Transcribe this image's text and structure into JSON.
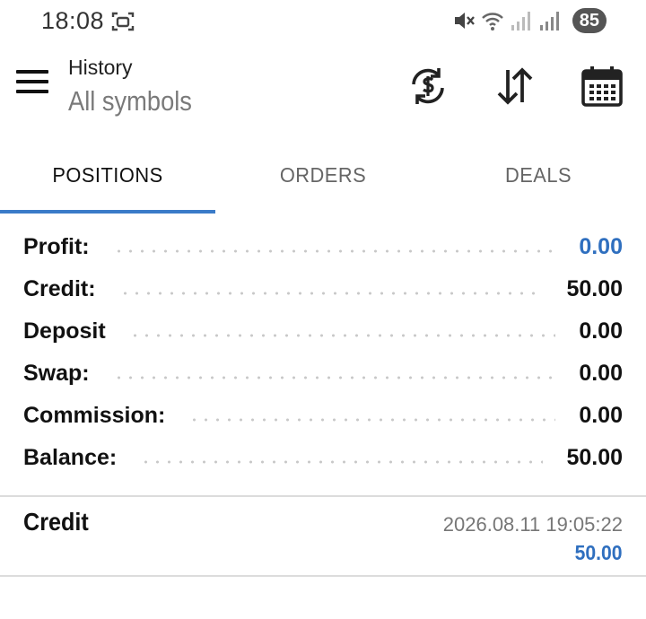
{
  "status_bar": {
    "time": "18:08",
    "battery": "85",
    "icons": [
      "screenshot-icon",
      "mute-icon",
      "wifi-icon",
      "signal-icon",
      "signal-icon"
    ]
  },
  "header": {
    "title": "History",
    "subtitle": "All symbols",
    "actions": [
      "currency-sync-icon",
      "sort-icon",
      "calendar-icon"
    ]
  },
  "tabs": [
    {
      "label": "POSITIONS",
      "active": true
    },
    {
      "label": "ORDERS",
      "active": false
    },
    {
      "label": "DEALS",
      "active": false
    }
  ],
  "summary": [
    {
      "label": "Profit:",
      "value": "0.00",
      "color": "#2f6fbf"
    },
    {
      "label": "Credit:",
      "value": "50.00",
      "color": "#111111"
    },
    {
      "label": "Deposit",
      "value": "0.00",
      "color": "#111111"
    },
    {
      "label": "Swap:",
      "value": "0.00",
      "color": "#111111"
    },
    {
      "label": "Commission:",
      "value": "0.00",
      "color": "#111111"
    },
    {
      "label": "Balance:",
      "value": "50.00",
      "color": "#111111"
    }
  ],
  "deal": {
    "title": "Credit",
    "datetime": "2026.08.11 19:05:22",
    "amount": "50.00"
  },
  "colors": {
    "accent": "#3a7bc8",
    "value_blue": "#2f6fbf"
  }
}
